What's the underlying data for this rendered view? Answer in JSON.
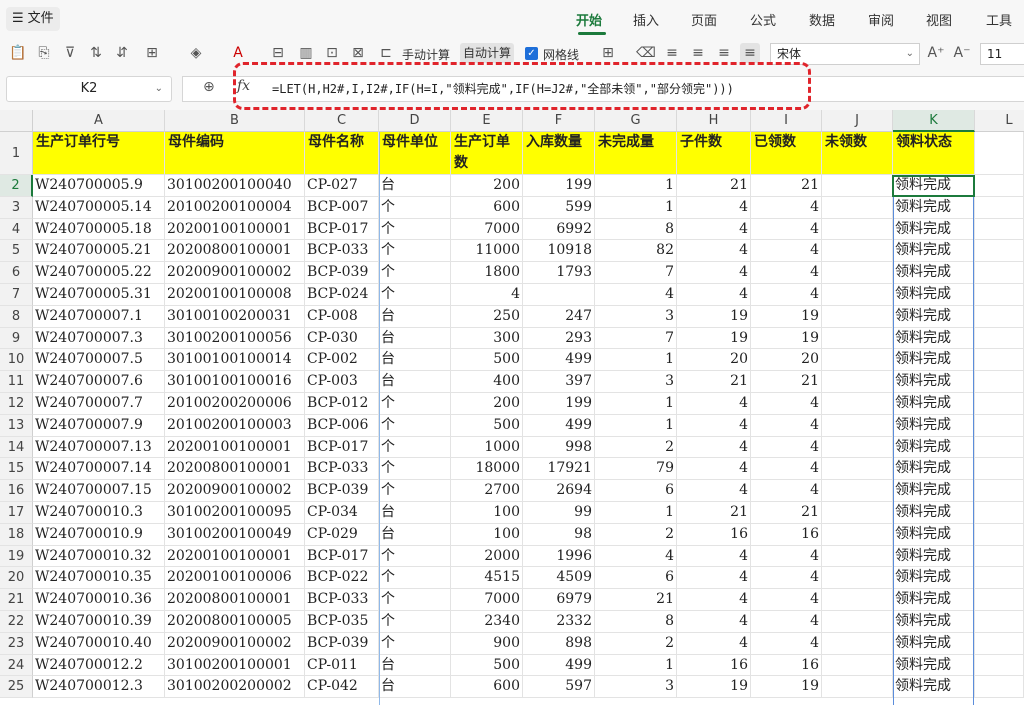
{
  "menu": {
    "file_label": "文件",
    "tabs": [
      "开始",
      "插入",
      "页面",
      "公式",
      "数据",
      "审阅",
      "视图",
      "工具"
    ],
    "active_tab": "开始"
  },
  "toolbar": {
    "manual_calc": "手动计算",
    "auto_calc": "自动计算",
    "gridlines": "网格线",
    "font_name": "宋体",
    "font_size": "11"
  },
  "formula_bar": {
    "cell_ref": "K2",
    "formula": "=LET(H,H2#,I,I2#,IF(H=I,\"领料完成\",IF(H=J2#,\"全部未领\",\"部分领完\")))"
  },
  "sheet": {
    "columns": [
      "A",
      "B",
      "C",
      "D",
      "E",
      "F",
      "G",
      "H",
      "I",
      "J",
      "K",
      "L"
    ],
    "active_column": "K",
    "active_row": "2",
    "headers": [
      "生产订单行号",
      "母件编码",
      "母件名称",
      "母件单位",
      "生产订单数",
      "入库数量",
      "未完成量",
      "子件数",
      "已领数",
      "未领数",
      "领料状态"
    ],
    "rows": [
      [
        "2",
        "W240700005.9",
        "30100200100040",
        "CP-027",
        "台",
        "200",
        "199",
        "1",
        "21",
        "21",
        "",
        "领料完成"
      ],
      [
        "3",
        "W240700005.14",
        "20100200100004",
        "BCP-007",
        "个",
        "600",
        "599",
        "1",
        "4",
        "4",
        "",
        "领料完成"
      ],
      [
        "4",
        "W240700005.18",
        "20200100100001",
        "BCP-017",
        "个",
        "7000",
        "6992",
        "8",
        "4",
        "4",
        "",
        "领料完成"
      ],
      [
        "5",
        "W240700005.21",
        "20200800100001",
        "BCP-033",
        "个",
        "11000",
        "10918",
        "82",
        "4",
        "4",
        "",
        "领料完成"
      ],
      [
        "6",
        "W240700005.22",
        "20200900100002",
        "BCP-039",
        "个",
        "1800",
        "1793",
        "7",
        "4",
        "4",
        "",
        "领料完成"
      ],
      [
        "7",
        "W240700005.31",
        "20200100100008",
        "BCP-024",
        "个",
        "4",
        "",
        "4",
        "4",
        "4",
        "",
        "领料完成"
      ],
      [
        "8",
        "W240700007.1",
        "30100100200031",
        "CP-008",
        "台",
        "250",
        "247",
        "3",
        "19",
        "19",
        "",
        "领料完成"
      ],
      [
        "9",
        "W240700007.3",
        "30100200100056",
        "CP-030",
        "台",
        "300",
        "293",
        "7",
        "19",
        "19",
        "",
        "领料完成"
      ],
      [
        "10",
        "W240700007.5",
        "30100100100014",
        "CP-002",
        "台",
        "500",
        "499",
        "1",
        "20",
        "20",
        "",
        "领料完成"
      ],
      [
        "11",
        "W240700007.6",
        "30100100100016",
        "CP-003",
        "台",
        "400",
        "397",
        "3",
        "21",
        "21",
        "",
        "领料完成"
      ],
      [
        "12",
        "W240700007.7",
        "20100200200006",
        "BCP-012",
        "个",
        "200",
        "199",
        "1",
        "4",
        "4",
        "",
        "领料完成"
      ],
      [
        "13",
        "W240700007.9",
        "20100200100003",
        "BCP-006",
        "个",
        "500",
        "499",
        "1",
        "4",
        "4",
        "",
        "领料完成"
      ],
      [
        "14",
        "W240700007.13",
        "20200100100001",
        "BCP-017",
        "个",
        "1000",
        "998",
        "2",
        "4",
        "4",
        "",
        "领料完成"
      ],
      [
        "15",
        "W240700007.14",
        "20200800100001",
        "BCP-033",
        "个",
        "18000",
        "17921",
        "79",
        "4",
        "4",
        "",
        "领料完成"
      ],
      [
        "16",
        "W240700007.15",
        "20200900100002",
        "BCP-039",
        "个",
        "2700",
        "2694",
        "6",
        "4",
        "4",
        "",
        "领料完成"
      ],
      [
        "17",
        "W240700010.3",
        "30100200100095",
        "CP-034",
        "台",
        "100",
        "99",
        "1",
        "21",
        "21",
        "",
        "领料完成"
      ],
      [
        "18",
        "W240700010.9",
        "30100200100049",
        "CP-029",
        "台",
        "100",
        "98",
        "2",
        "16",
        "16",
        "",
        "领料完成"
      ],
      [
        "19",
        "W240700010.32",
        "20200100100001",
        "BCP-017",
        "个",
        "2000",
        "1996",
        "4",
        "4",
        "4",
        "",
        "领料完成"
      ],
      [
        "20",
        "W240700010.35",
        "20200100100006",
        "BCP-022",
        "个",
        "4515",
        "4509",
        "6",
        "4",
        "4",
        "",
        "领料完成"
      ],
      [
        "21",
        "W240700010.36",
        "20200800100001",
        "BCP-033",
        "个",
        "7000",
        "6979",
        "21",
        "4",
        "4",
        "",
        "领料完成"
      ],
      [
        "22",
        "W240700010.39",
        "20200800100005",
        "BCP-035",
        "个",
        "2340",
        "2332",
        "8",
        "4",
        "4",
        "",
        "领料完成"
      ],
      [
        "23",
        "W240700010.40",
        "20200900100002",
        "BCP-039",
        "个",
        "900",
        "898",
        "2",
        "4",
        "4",
        "",
        "领料完成"
      ],
      [
        "24",
        "W240700012.2",
        "30100200100001",
        "CP-011",
        "台",
        "500",
        "499",
        "1",
        "16",
        "16",
        "",
        "领料完成"
      ],
      [
        "25",
        "W240700012.3",
        "30100200200002",
        "CP-042",
        "台",
        "600",
        "597",
        "3",
        "19",
        "19",
        "",
        "领料完成"
      ]
    ]
  },
  "colors": {
    "accent": "#1c7a3c",
    "header_fill": "#ffff00",
    "annotation": "#e0242b"
  }
}
